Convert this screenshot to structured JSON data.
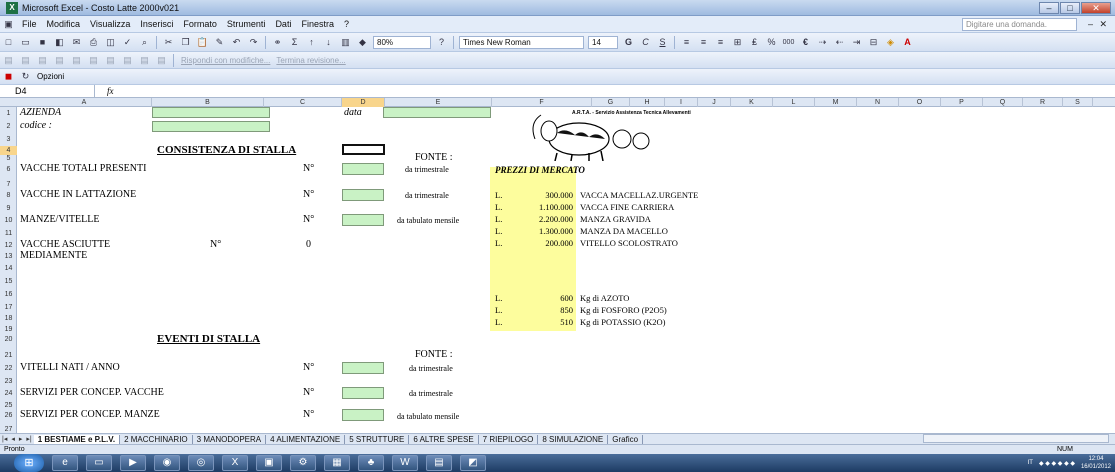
{
  "window": {
    "title": "Microsoft Excel - Costo Latte 2000v021",
    "icon": "excel-icon",
    "btn_min": "–",
    "btn_max": "□",
    "btn_close": "✕"
  },
  "menu": [
    "File",
    "Modifica",
    "Visualizza",
    "Inserisci",
    "Formato",
    "Strumenti",
    "Dati",
    "Finestra",
    "?"
  ],
  "help_placeholder": "Digitare una domanda.",
  "toolbar": {
    "zoom": "80%",
    "font": "Times New Roman",
    "size": "14",
    "bold": "G",
    "italic": "C",
    "underline": "S",
    "percent": "%",
    "thousands": "000",
    "euro": "€",
    "review": "Rispondi con modifiche...",
    "end_review": "Termina revisione...",
    "options": "Opzioni"
  },
  "formula": {
    "cell": "D4",
    "fx": "fx",
    "content": ""
  },
  "columns": [
    "A",
    "B",
    "C",
    "D",
    "E",
    "F",
    "G",
    "H",
    "I",
    "J",
    "K",
    "L",
    "M",
    "N",
    "O",
    "P",
    "Q",
    "R",
    "S"
  ],
  "rows": [
    "1",
    "2",
    "3",
    "4",
    "5",
    "6",
    "7",
    "8",
    "9",
    "10",
    "11",
    "12",
    "13",
    "14",
    "15",
    "16",
    "17",
    "18",
    "19",
    "20",
    "21",
    "22",
    "23",
    "24",
    "25",
    "26",
    "27"
  ],
  "cells": {
    "azienda": "AZIENDA",
    "data": "data",
    "codice": "codice :",
    "consistenza": "CONSISTENZA DI STALLA",
    "fonte1": "FONTE :",
    "vacche_tot": "VACCHE TOTALI PRESENTI",
    "n1": "N°",
    "trim1": "da trimestrale",
    "prezzi": "PREZZI DI MERCATO",
    "vacche_latt": "VACCHE  IN LATTAZIONE",
    "n2": "N°",
    "trim2": "da trimestrale",
    "manze": "MANZE/VITELLE",
    "n3": "N°",
    "tab1": "da tabulato mensile",
    "asciutte": "VACCHE ASCIUTTE",
    "n4": "N°",
    "zero": "0",
    "mediamente": "MEDIAMENTE",
    "eventi": "EVENTI DI STALLA",
    "fonte2": "FONTE :",
    "vitelli": "VITELLI NATI / ANNO",
    "n5": "N°",
    "trim3": "da trimestrale",
    "serv_vacche": "SERVIZI PER CONCEP. VACCHE",
    "n6": "N°",
    "trim4": "da trimestrale",
    "serv_manze": "SERVIZI PER CONCEP. MANZE",
    "n7": "N°",
    "tab2": "da tabulato mensile",
    "logo_text": "A.R.T.A. - Servizio Assistenza Tecnica Allevamenti"
  },
  "prices": [
    {
      "cur": "L.",
      "val": "300.000",
      "desc": "VACCA MACELLAZ.URGENTE"
    },
    {
      "cur": "L.",
      "val": "1.100.000",
      "desc": "VACCA FINE CARRIERA"
    },
    {
      "cur": "L.",
      "val": "2.200.000",
      "desc": "MANZA GRAVIDA"
    },
    {
      "cur": "L.",
      "val": "1.300.000",
      "desc": "MANZA DA MACELLO"
    },
    {
      "cur": "L.",
      "val": "200.000",
      "desc": "VITELLO SCOLOSTRATO"
    }
  ],
  "fertil": [
    {
      "cur": "L.",
      "val": "600",
      "desc": "Kg di AZOTO"
    },
    {
      "cur": "L.",
      "val": "850",
      "desc": "Kg di FOSFORO (P2O5)"
    },
    {
      "cur": "L.",
      "val": "510",
      "desc": "Kg di POTASSIO (K2O)"
    }
  ],
  "sheets": [
    "1 BESTIAME e P.L.V.",
    "2 MACCHINARIO",
    "3 MANODOPERA",
    "4 ALIMENTAZIONE",
    "5 STRUTTURE",
    "6 ALTRE SPESE",
    "7 RIEPILOGO",
    "8 SIMULAZIONE",
    "Grafico"
  ],
  "status": {
    "ready": "Pronto",
    "num": "NUM"
  },
  "tray": {
    "lang": "IT",
    "time": "12:04",
    "date": "16/01/2012"
  }
}
